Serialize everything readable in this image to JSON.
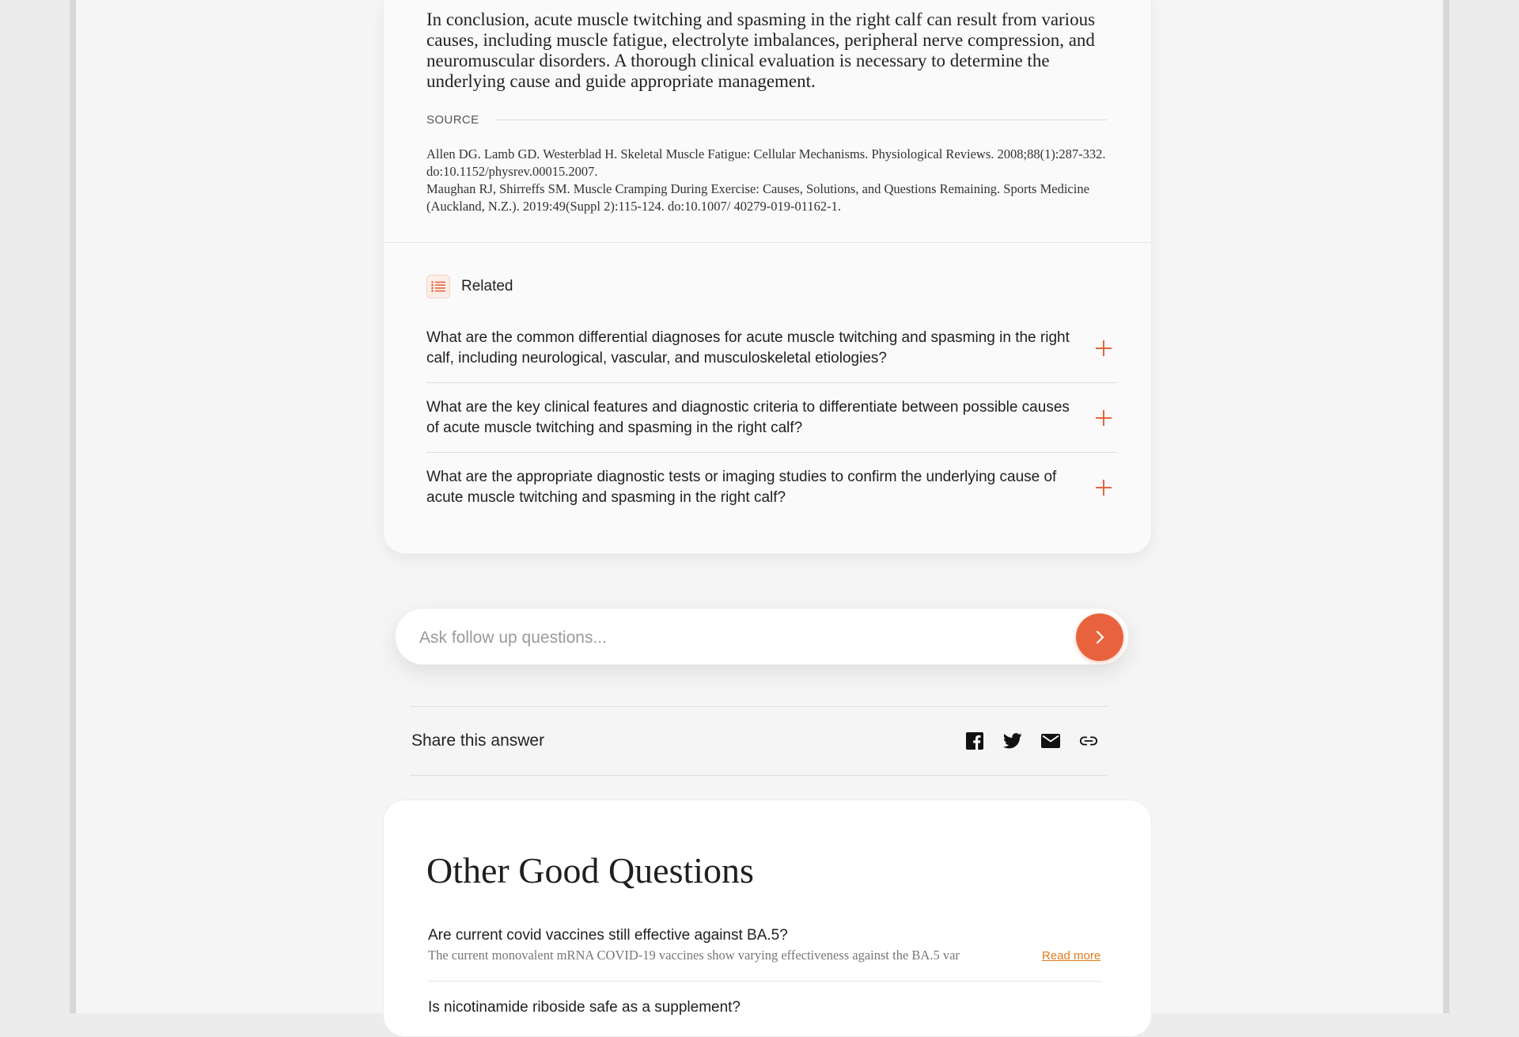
{
  "answer": {
    "conclusion": "In conclusion, acute muscle twitching and spasming in the right calf can result from various causes, including muscle fatigue, electrolyte imbalances, peripheral nerve compression, and neuromuscular disorders. A thorough clinical evaluation is necessary to determine the underlying cause and guide appropriate management.",
    "source_label": "SOURCE",
    "citations": [
      "Allen DG. Lamb GD. Westerblad H. Skeletal Muscle Fatigue: Cellular Mechanisms. Physiological Reviews. 2008;88(1):287-332. do:10.1152/physrev.00015.2007.",
      "Maughan RJ, Shirreffs SM. Muscle Cramping During Exercise: Causes, Solutions, and Questions Remaining. Sports Medicine (Auckland, N.Z.). 2019:49(Suppl 2):115-124. do:10.1007/ 40279-019-01162-1."
    ]
  },
  "related": {
    "title": "Related",
    "icon": "list-icon",
    "items": [
      "What are the common differential diagnoses for acute muscle twitching and spasming in the right calf, including neurological, vascular, and musculoskeletal etiologies?",
      "What are the key clinical features and diagnostic criteria to differentiate between possible causes of acute muscle twitching and spasming in the right calf?",
      "What are the appropriate diagnostic tests or imaging studies to confirm the underlying cause of acute muscle twitching and spasming in the right calf?"
    ]
  },
  "followup": {
    "placeholder": "Ask follow up questions...",
    "value": ""
  },
  "share": {
    "label": "Share this answer",
    "icons": [
      "facebook-icon",
      "twitter-icon",
      "email-icon",
      "link-icon"
    ]
  },
  "other_questions": {
    "title": "Other Good Questions",
    "read_more": "Read more",
    "items": [
      {
        "question": "Are current covid vaccines still effective against BA.5?",
        "excerpt": "The current monovalent mRNA COVID-19 vaccines show varying effectiveness against the BA.5 var"
      },
      {
        "question": "Is nicotinamide riboside safe as a supplement?"
      }
    ]
  },
  "colors": {
    "accent": "#e8633d",
    "link": "#e07a1f",
    "page_bg": "#f5f5f5"
  }
}
